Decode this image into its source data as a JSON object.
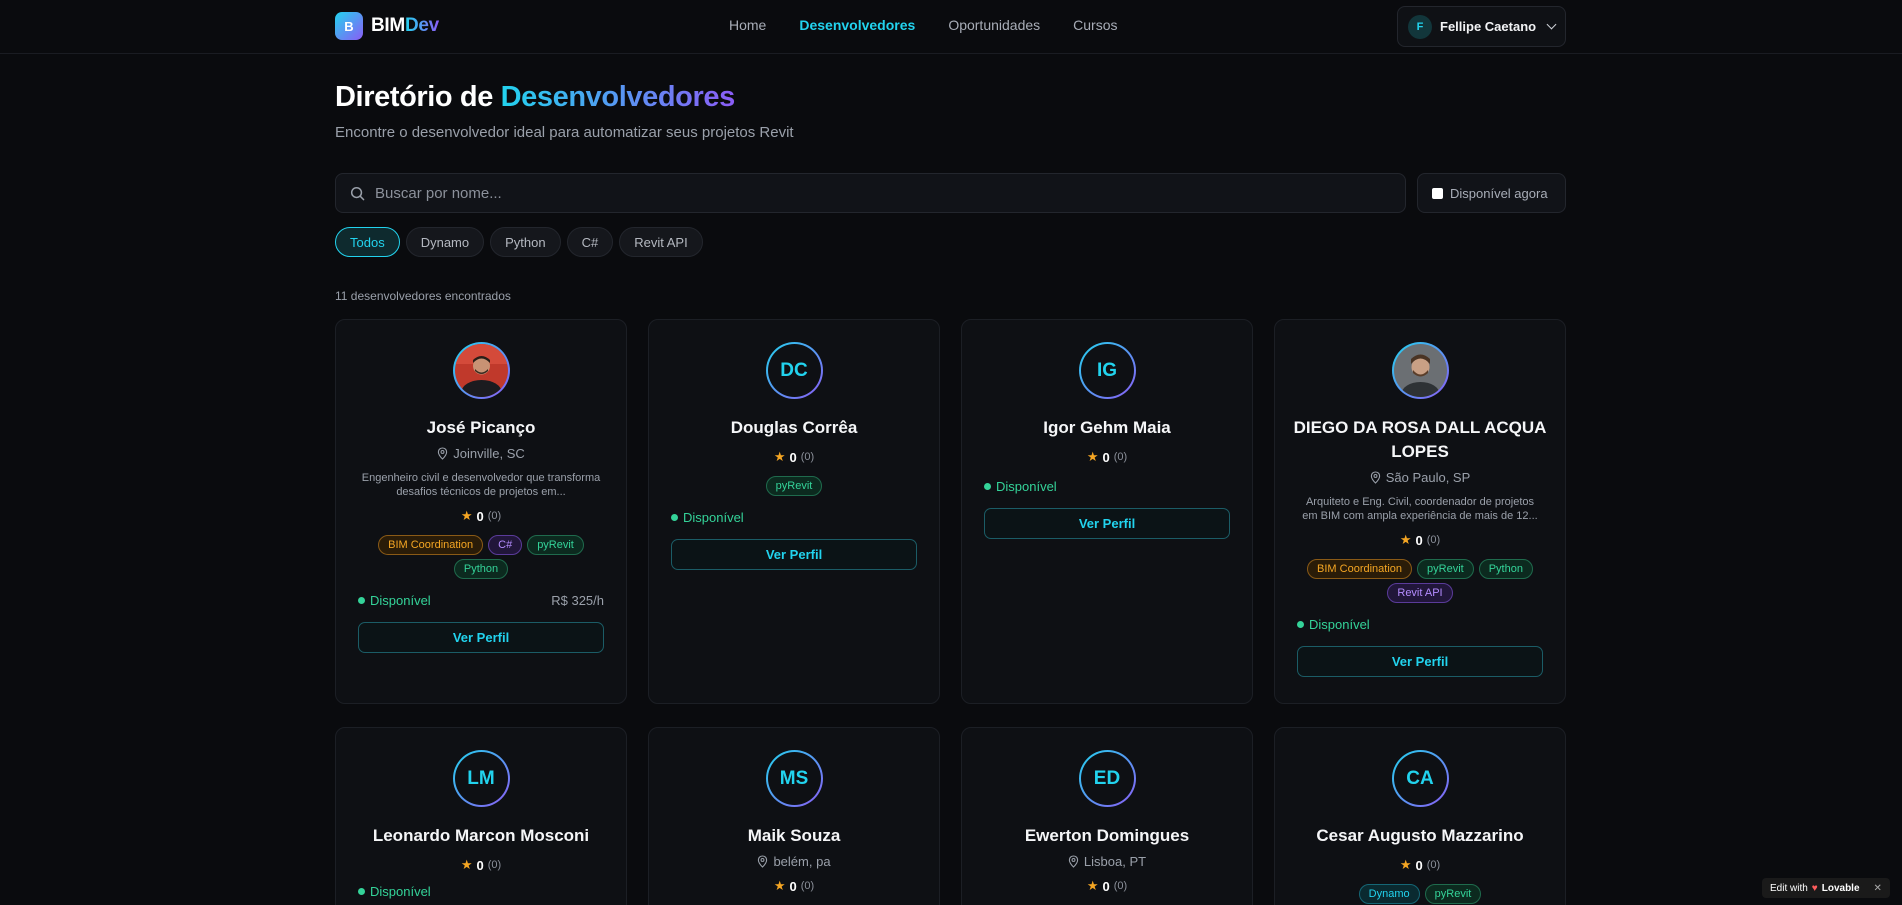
{
  "header": {
    "logo_letter": "B",
    "logo_part1": "BIM",
    "logo_part2": "Dev",
    "nav": [
      "Home",
      "Desenvolvedores",
      "Oportunidades",
      "Cursos"
    ],
    "user_initial": "F",
    "user_name": "Fellipe Caetano"
  },
  "page": {
    "title_part1": "Diretório de",
    "title_part2": "Desenvolvedores",
    "subtitle": "Encontre o desenvolvedor ideal para automatizar seus projetos Revit",
    "search_placeholder": "Buscar por nome...",
    "available_label": "Disponível agora",
    "filters": [
      "Todos",
      "Dynamo",
      "Python",
      "C#",
      "Revit API"
    ],
    "active_filter": "Todos",
    "count_text": "11 desenvolvedores encontrados"
  },
  "cards": [
    {
      "initials": "",
      "name": "José Picanço",
      "location": "Joinville, SC",
      "bio": "Engenheiro civil e desenvolvedor que transforma desafios técnicos de projetos em...",
      "rating": "0",
      "rating_count": "(0)",
      "tags": [
        "BIM Coordination",
        "C#",
        "pyRevit",
        "Python"
      ],
      "available": "Disponível",
      "price": "R$ 325/h",
      "button": "Ver Perfil"
    },
    {
      "initials": "DC",
      "name": "Douglas Corrêa",
      "rating": "0",
      "rating_count": "(0)",
      "tags": [
        "pyRevit"
      ],
      "available": "Disponível",
      "button": "Ver Perfil"
    },
    {
      "initials": "IG",
      "name": "Igor Gehm Maia",
      "rating": "0",
      "rating_count": "(0)",
      "available": "Disponível",
      "button": "Ver Perfil"
    },
    {
      "initials": "",
      "name": "DIEGO DA ROSA DALL ACQUA LOPES",
      "location": "São Paulo, SP",
      "bio": "Arquiteto e Eng. Civil, coordenador de projetos em BIM com ampla experiência de mais de 12...",
      "rating": "0",
      "rating_count": "(0)",
      "tags": [
        "BIM Coordination",
        "pyRevit",
        "Python",
        "Revit API"
      ],
      "available": "Disponível",
      "button": "Ver Perfil"
    },
    {
      "initials": "LM",
      "name": "Leonardo Marcon Mosconi",
      "rating": "0",
      "rating_count": "(0)",
      "available": "Disponível"
    },
    {
      "initials": "MS",
      "name": "Maik Souza",
      "location": "belém, pa",
      "rating": "0",
      "rating_count": "(0)"
    },
    {
      "initials": "ED",
      "name": "Ewerton Domingues",
      "location": "Lisboa, PT",
      "rating": "0",
      "rating_count": "(0)"
    },
    {
      "initials": "CA",
      "name": "Cesar Augusto Mazzarino",
      "rating": "0",
      "rating_count": "(0)",
      "tags": [
        "Dynamo",
        "pyRevit"
      ]
    }
  ],
  "badge": {
    "edit_with": "Edit with",
    "brand": "Lovable"
  },
  "colors": {
    "accent": "#22d3ee",
    "accent2": "#8b5cf6",
    "available": "#34d399",
    "star": "#f5a623",
    "background": "#0a0b0e"
  }
}
